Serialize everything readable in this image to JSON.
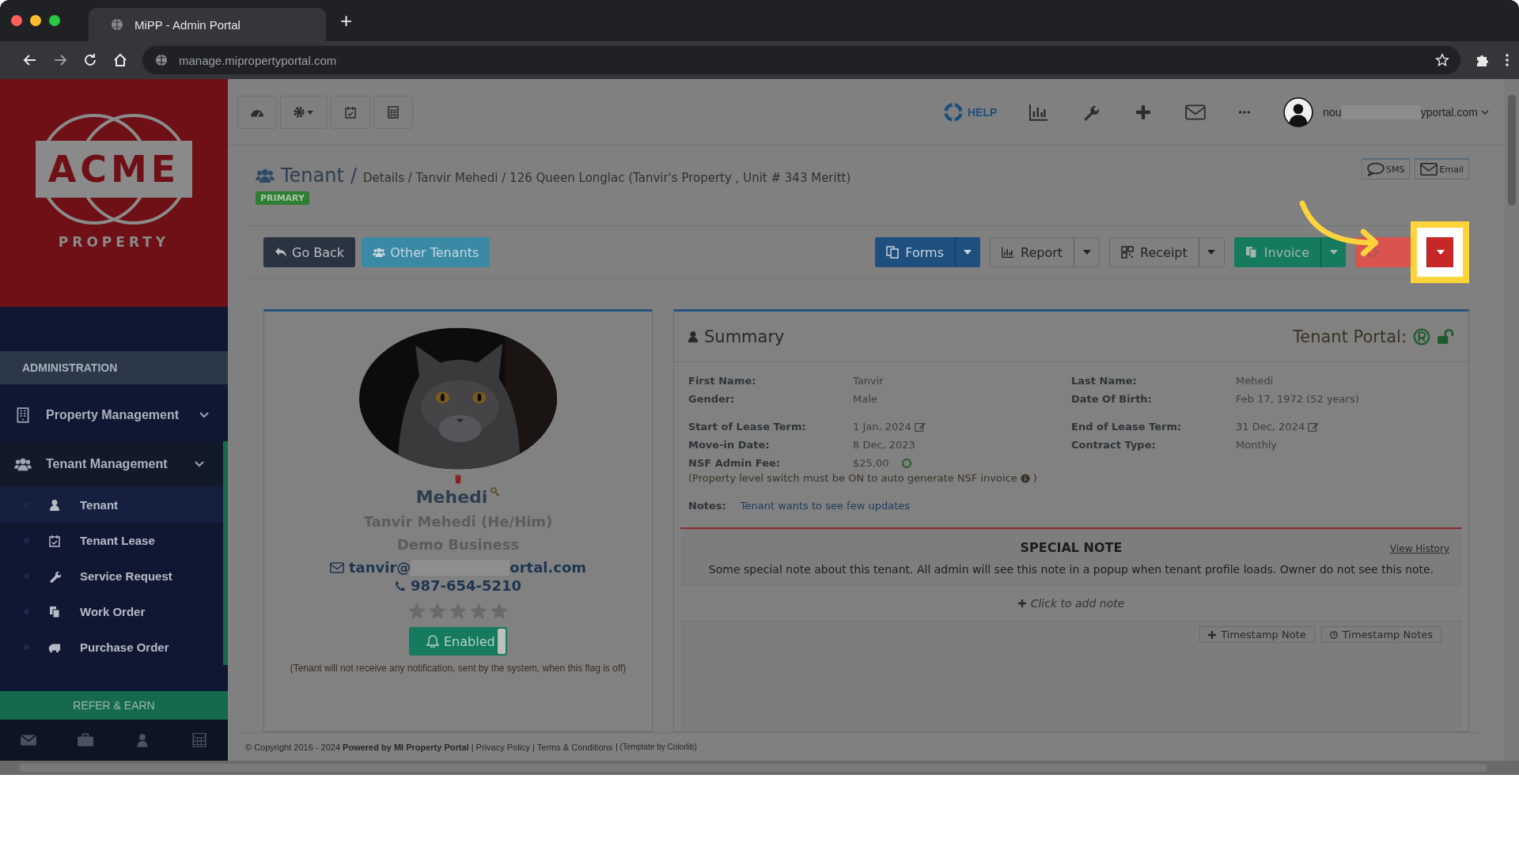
{
  "browser": {
    "tab_title": "MiPP - Admin Portal",
    "new_tab": "+",
    "url": "manage.mipropertyportal.com"
  },
  "sidebar": {
    "logo_text": "ACME",
    "logo_subtext": "PROPERTY",
    "section": "ADMINISTRATION",
    "menu": [
      {
        "label": "Property Management",
        "kind": "building",
        "selected": false
      },
      {
        "label": "Tenant Management",
        "kind": "users",
        "selected": true,
        "children": [
          {
            "label": "Tenant",
            "kind": "user",
            "selected": true
          },
          {
            "label": "Tenant Lease",
            "kind": "calendar",
            "selected": false
          },
          {
            "label": "Service Request",
            "kind": "wrench",
            "selected": false
          },
          {
            "label": "Work Order",
            "kind": "copy",
            "selected": false
          },
          {
            "label": "Purchase Order",
            "kind": "truck",
            "selected": false
          }
        ]
      }
    ],
    "refer": "REFER & EARN"
  },
  "topbar": {
    "help": "HELP",
    "user_email_start": "nou",
    "user_email_end": "yportal.com"
  },
  "breadcrumb": {
    "title": "Tenant",
    "separator": "/",
    "path": "Details / Tanvir Mehedi / 126 Queen Longlac (Tanvir's Property , Unit # 343 Meritt)",
    "badge": "PRIMARY"
  },
  "contact_buttons": [
    {
      "label": "SMS",
      "kind": "sms"
    },
    {
      "label": "Email",
      "kind": "email"
    }
  ],
  "actions_left": [
    {
      "label": "Go Back",
      "kind": "back"
    },
    {
      "label": "Other Tenants",
      "kind": "tenants"
    }
  ],
  "actions_right": [
    {
      "label": "Forms",
      "kind": "forms",
      "highlighted": false
    },
    {
      "label": "Report",
      "kind": "report",
      "highlighted": false
    },
    {
      "label": "Receipt",
      "kind": "receipt",
      "highlighted": false
    },
    {
      "label": "Invoice",
      "kind": "invoice",
      "highlighted": false
    },
    {
      "kind": "action",
      "highlighted": true
    }
  ],
  "profile": {
    "name": "Mehedi",
    "full_name": "Tanvir Mehedi (He/Him)",
    "business": "Demo Business",
    "email_start": "tanvir@",
    "email_end": "ortal.com",
    "phone": "987-654-5210",
    "stars": 0,
    "notification": {
      "label": "Enabled",
      "on": true
    },
    "note": "(Tenant will not receive any notification, sent by the system, when this flag is off)"
  },
  "summary": {
    "title": "Summary",
    "portal_label": "Tenant Portal:",
    "field_groups": [
      {
        "fields": [
          {
            "label": "First Name:",
            "value": "Tanvir",
            "kind": "text"
          },
          {
            "label": "Last Name:",
            "value": "Mehedi",
            "kind": "text"
          },
          {
            "label": "Gender:",
            "value": "Male",
            "kind": "text"
          },
          {
            "label": "Date Of Birth:",
            "value": "Feb 17, 1972 (52 years)",
            "kind": "text"
          }
        ]
      },
      {
        "fields": [
          {
            "label": "Start of Lease Term:",
            "value": "1 Jan, 2024",
            "kind": "editable"
          },
          {
            "label": "End of Lease Term:",
            "value": "31 Dec, 2024",
            "kind": "editable"
          },
          {
            "label": "Move-in Date:",
            "value": "8 Dec, 2023",
            "kind": "text"
          },
          {
            "label": "Contract Type:",
            "value": "Monthly",
            "kind": "text"
          },
          {
            "label": "NSF Admin Fee:",
            "value": "$25.00",
            "kind": "toggle",
            "on": false
          }
        ]
      }
    ],
    "nsf_note_start": "(Property level switch must be ON to auto generate NSF invoice",
    "nsf_note_end": ")",
    "notes_label": "Notes:",
    "notes": "Tenant wants to see few updates",
    "special_note": {
      "title": "SPECIAL NOTE",
      "history": "View History",
      "text": "Some special note about this tenant. All admin will see this note in a popup when tenant profile loads. Owner do not see this note.",
      "add": "Click to add note",
      "buttons": [
        {
          "label": "Timestamp Note",
          "kind": "add"
        },
        {
          "label": "Timestamp Notes",
          "kind": "history"
        }
      ]
    }
  },
  "footer": {
    "copyright": "© Copyright 2016 - 2024 **Powered by MI Property Portal** | Privacy Policy | Terms & Conditions",
    "template": "| (Template by Colorlib)"
  }
}
